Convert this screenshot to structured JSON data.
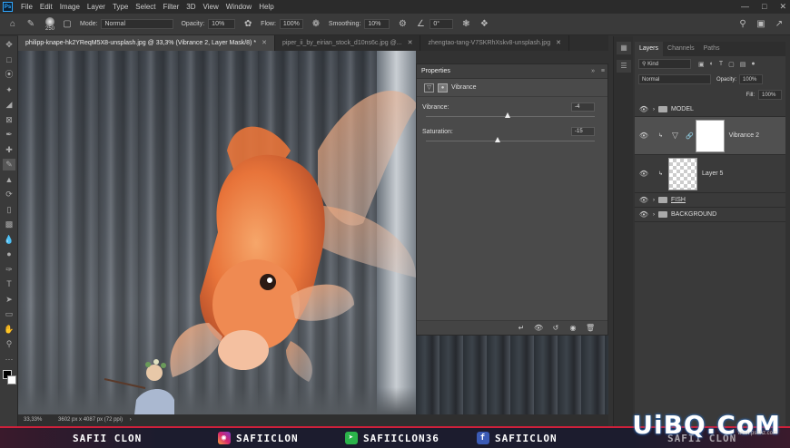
{
  "menubar": {
    "logo": "Ps",
    "items": [
      "File",
      "Edit",
      "Image",
      "Layer",
      "Type",
      "Select",
      "Filter",
      "3D",
      "View",
      "Window",
      "Help"
    ]
  },
  "options": {
    "brush_size": "250",
    "mode_label": "Mode:",
    "mode_value": "Normal",
    "opacity_label": "Opacity:",
    "opacity_value": "10%",
    "flow_label": "Flow:",
    "flow_value": "100%",
    "smoothing_label": "Smoothing:",
    "smoothing_value": "10%",
    "angle_value": "0°"
  },
  "tabs": [
    {
      "label": "philipp-knape-hk2YReqM5X8-unsplash.jpg @ 33,3% (Vibrance 2, Layer Mask/8) *",
      "active": true
    },
    {
      "label": "piper_ii_by_eirian_stock_d10ns6c.jpg @..."
    },
    {
      "label": "zhengtao-tang-V7SKRhXskv8-unsplash.jpg"
    }
  ],
  "properties": {
    "panel_title": "Properties",
    "adjustment_name": "Vibrance",
    "vibrance_label": "Vibrance:",
    "vibrance_value": "-4",
    "vibrance_pos": 0.48,
    "saturation_label": "Saturation:",
    "saturation_value": "-15",
    "saturation_pos": 0.42
  },
  "layers_panel": {
    "tabs": [
      "Layers",
      "Channels",
      "Paths"
    ],
    "filter_value": "Kind",
    "blend_mode": "Normal",
    "opacity_label": "Opacity:",
    "opacity_value": "100%",
    "fill_label": "Fill:",
    "fill_value": "100%",
    "layers": [
      {
        "name": "MODEL",
        "type": "group"
      },
      {
        "name": "Vibrance 2",
        "type": "adjustment"
      },
      {
        "name": "Layer 5",
        "type": "pixel"
      },
      {
        "name": "FISH",
        "type": "group"
      },
      {
        "name": "BACKGROUND",
        "type": "group"
      }
    ]
  },
  "status": {
    "zoom": "33,33%",
    "doc_size": "3602 px x 4087 px (72 ppi)"
  },
  "banner": {
    "name": "SAFII CLON",
    "instagram": "SAFIICLON",
    "other": "SAFIICLON36",
    "facebook": "SAFIICLON",
    "right_name": "SAFII CLON"
  },
  "watermark": {
    "text": "UiBQ.CoM",
    "sub": "www.psahz.com"
  },
  "colors": {
    "accent": "#31a8ff",
    "banner_red": "#d0203a",
    "fish_orange": "#e8743a"
  }
}
